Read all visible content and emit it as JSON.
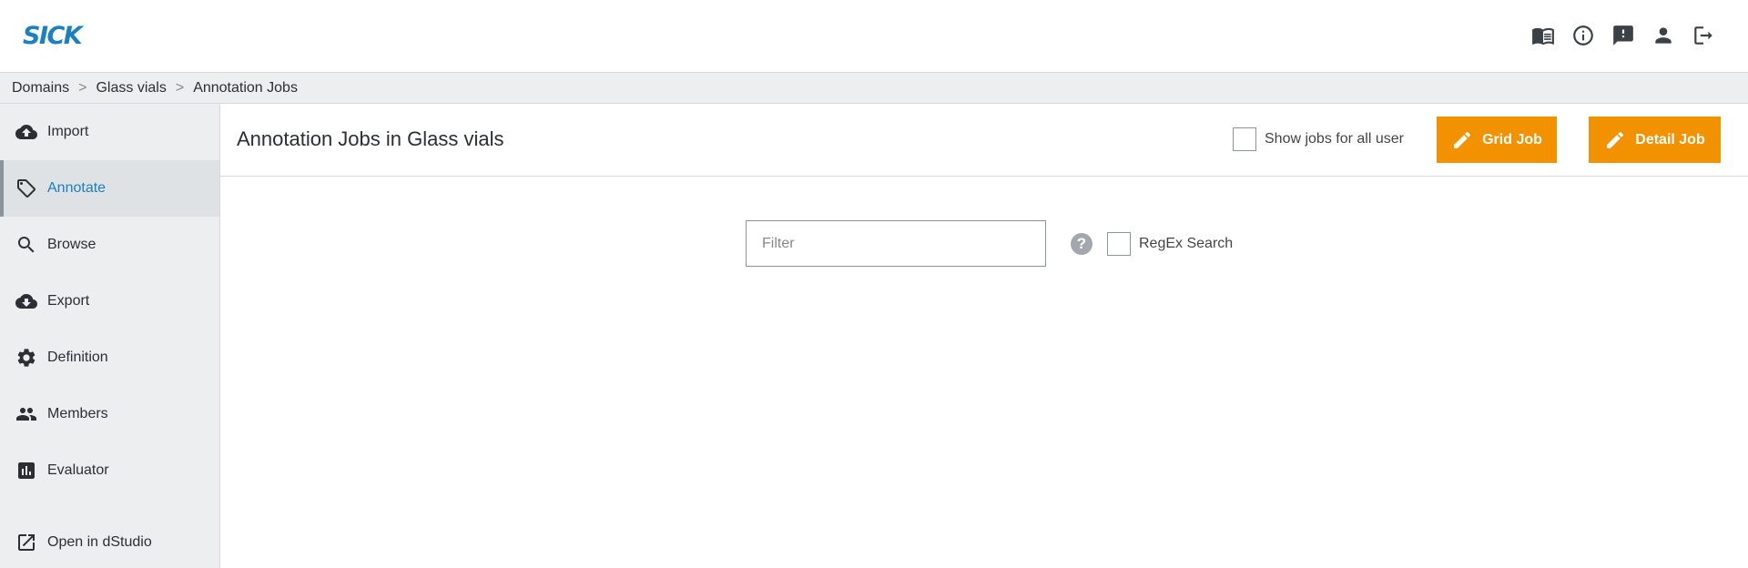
{
  "brand": {
    "logo": "SICK"
  },
  "header_icons": [
    "manual-icon",
    "info-icon",
    "feedback-icon",
    "user-icon",
    "logout-icon"
  ],
  "breadcrumb": {
    "items": [
      "Domains",
      "Glass vials",
      "Annotation Jobs"
    ],
    "separator": ">"
  },
  "sidebar": {
    "items": [
      {
        "label": "Import",
        "icon": "cloud-upload-icon"
      },
      {
        "label": "Annotate",
        "icon": "tag-icon",
        "active": true
      },
      {
        "label": "Browse",
        "icon": "search-icon"
      },
      {
        "label": "Export",
        "icon": "cloud-download-icon"
      },
      {
        "label": "Definition",
        "icon": "gear-icon"
      },
      {
        "label": "Members",
        "icon": "people-icon"
      },
      {
        "label": "Evaluator",
        "icon": "bar-chart-icon"
      },
      {
        "label": "Open in dStudio",
        "icon": "open-external-icon"
      }
    ]
  },
  "main": {
    "title": "Annotation Jobs in Glass vials",
    "show_all_label": "Show jobs for all user",
    "grid_job_label": "Grid Job",
    "detail_job_label": "Detail Job",
    "filter_placeholder": "Filter",
    "help_symbol": "?",
    "regex_label": "RegEx Search"
  },
  "colors": {
    "accent": "#f39200",
    "brand": "#1a7fc4",
    "sidebar_bg": "#eceef0"
  }
}
